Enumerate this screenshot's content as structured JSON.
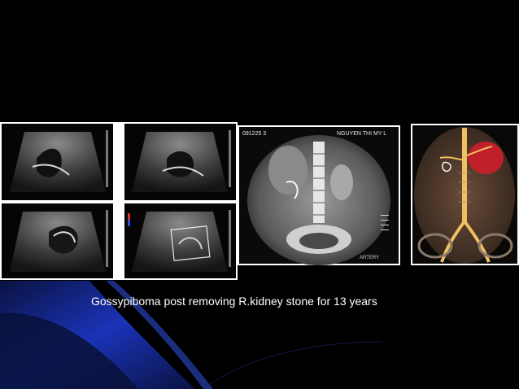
{
  "slide": {
    "caption": "Gossypiboma post removing R.kidney stone for 13 years",
    "colors": {
      "background": "#000000",
      "swoosh_dark": "#0a1040",
      "swoosh_bright": "#1f3fd8",
      "caption_text": "#ffffff"
    }
  },
  "images": {
    "ultrasound": {
      "frames": 4
    },
    "ct_coronal": {
      "header_left": "091225 3",
      "header_right": "NGUYEN THI MY L",
      "footer": "ARTERY"
    },
    "ct_angiography": {
      "render": "3D volume"
    }
  }
}
